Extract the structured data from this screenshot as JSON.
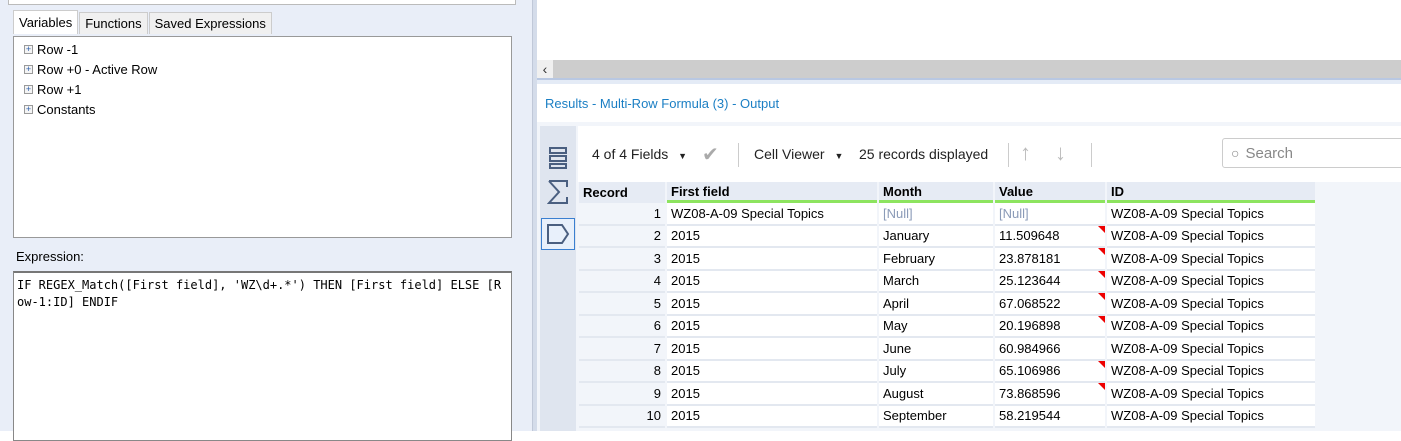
{
  "left": {
    "tabs": [
      "Variables",
      "Functions",
      "Saved Expressions"
    ],
    "tree": [
      "Row -1",
      "Row +0 - Active Row",
      "Row +1",
      "Constants"
    ],
    "expression_label": "Expression:",
    "expression": "IF REGEX_Match([First field], 'WZ\\d+.*') THEN [First field] ELSE [Row-1:ID] ENDIF"
  },
  "results": {
    "title": "Results - Multi-Row Formula (3) - Output",
    "toolbar": {
      "fields": "4 of 4 Fields",
      "viewer": "Cell Viewer",
      "records": "25 records displayed",
      "search_placeholder": "Search"
    },
    "columns": [
      "Record",
      "First field",
      "Month",
      "Value",
      "ID"
    ],
    "rows": [
      {
        "record": "1",
        "first": "WZ08-A-09 Special Topics",
        "month": "[Null]",
        "value": "[Null]",
        "id": "WZ08-A-09 Special Topics",
        "null": true,
        "flag": false
      },
      {
        "record": "2",
        "first": "2015",
        "month": "January",
        "value": "11.509648",
        "id": "WZ08-A-09 Special Topics",
        "flag": true
      },
      {
        "record": "3",
        "first": "2015",
        "month": "February",
        "value": "23.878181",
        "id": "WZ08-A-09 Special Topics",
        "flag": true
      },
      {
        "record": "4",
        "first": "2015",
        "month": "March",
        "value": "25.123644",
        "id": "WZ08-A-09 Special Topics",
        "flag": true
      },
      {
        "record": "5",
        "first": "2015",
        "month": "April",
        "value": "67.068522",
        "id": "WZ08-A-09 Special Topics",
        "flag": true
      },
      {
        "record": "6",
        "first": "2015",
        "month": "May",
        "value": "20.196898",
        "id": "WZ08-A-09 Special Topics",
        "flag": true
      },
      {
        "record": "7",
        "first": "2015",
        "month": "June",
        "value": "60.984966",
        "id": "WZ08-A-09 Special Topics",
        "flag": false
      },
      {
        "record": "8",
        "first": "2015",
        "month": "July",
        "value": "65.106986",
        "id": "WZ08-A-09 Special Topics",
        "flag": true
      },
      {
        "record": "9",
        "first": "2015",
        "month": "August",
        "value": "73.868596",
        "id": "WZ08-A-09 Special Topics",
        "flag": true
      },
      {
        "record": "10",
        "first": "2015",
        "month": "September",
        "value": "58.219544",
        "id": "WZ08-A-09 Special Topics",
        "flag": false
      }
    ]
  },
  "colors": {
    "accent": "#1b7fc4",
    "header_underline": "#8de45f",
    "flag": "#e00000"
  }
}
